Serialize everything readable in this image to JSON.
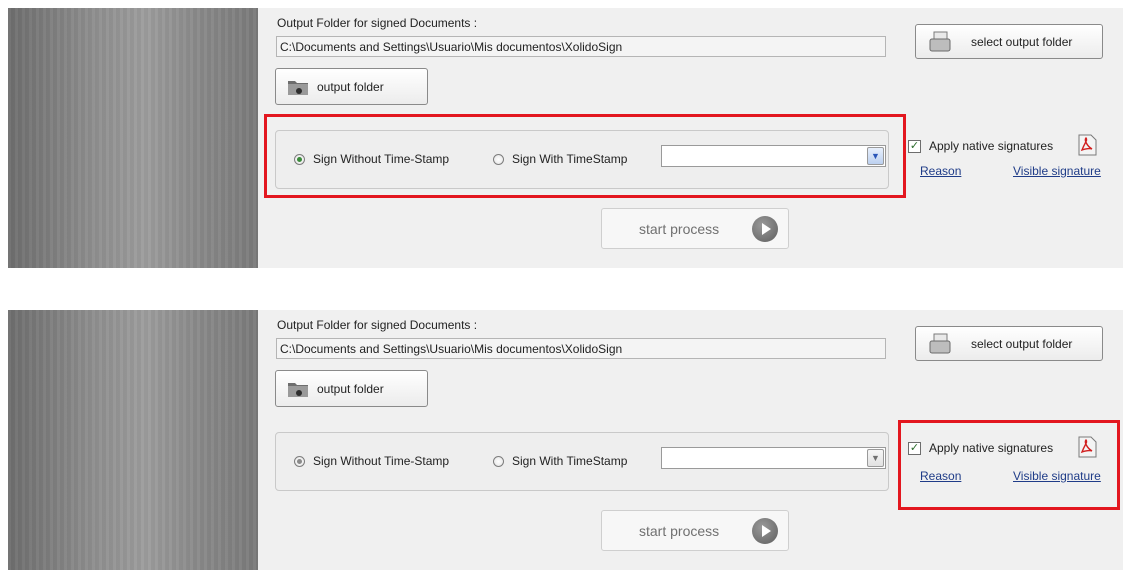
{
  "panels": [
    {
      "output_folder_label": "Output Folder for signed Documents :",
      "output_path": "C:\\Documents and Settings\\Usuario\\Mis documentos\\XolidoSign",
      "output_folder_button": "output folder",
      "select_output_folder_button": "select output folder",
      "radio_without_timestamp": "Sign Without Time-Stamp",
      "radio_with_timestamp": "Sign With TimeStamp",
      "timestamp_selected": "",
      "radio_without_timestamp_checked": true,
      "apply_native_signatures": "Apply native signatures",
      "apply_native_checked": true,
      "reason_link": "Reason",
      "visible_signature_link": "Visible signature",
      "start_button": "start process",
      "highlight": "signing-options-group"
    },
    {
      "output_folder_label": "Output Folder for signed Documents :",
      "output_path": "C:\\Documents and Settings\\Usuario\\Mis documentos\\XolidoSign",
      "output_folder_button": "output folder",
      "select_output_folder_button": "select output folder",
      "radio_without_timestamp": "Sign Without Time-Stamp",
      "radio_with_timestamp": "Sign With TimeStamp",
      "timestamp_selected": "",
      "radio_without_timestamp_checked": true,
      "apply_native_signatures": "Apply native signatures",
      "apply_native_checked": true,
      "reason_link": "Reason",
      "visible_signature_link": "Visible signature",
      "start_button": "start process",
      "highlight": "native-signatures-area"
    }
  ],
  "icons": {
    "output_folder": "folder-icon",
    "select_output_folder": "document-icon",
    "pdf": "pdf-icon",
    "start": "play-icon",
    "combo_arrow": "chevron-down-icon"
  },
  "colors": {
    "highlight": "#e3171f",
    "radio_dot_active": "#3a8a3a",
    "radio_dot_inactive": "#8a8a8a",
    "combo_arrow_active": "#2a56b8",
    "combo_arrow_inactive": "#707070",
    "link": "#1f3c88"
  }
}
